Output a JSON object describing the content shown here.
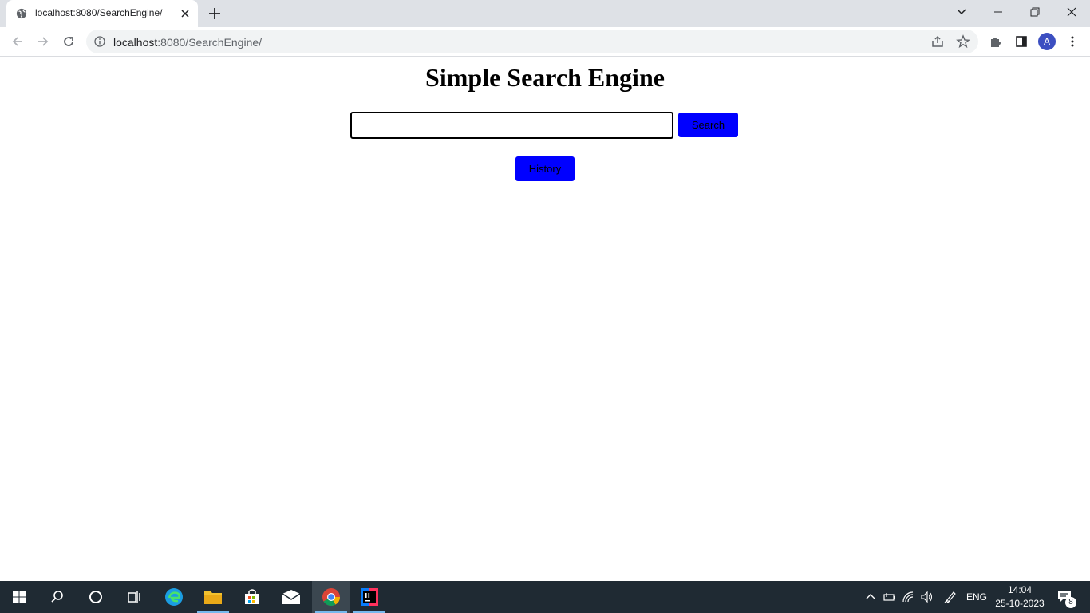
{
  "browser": {
    "tab": {
      "title": "localhost:8080/SearchEngine/"
    },
    "address": {
      "host": "localhost",
      "path": ":8080/SearchEngine/"
    },
    "profile_initial": "A"
  },
  "page": {
    "title": "Simple Search Engine",
    "search_input": {
      "value": "",
      "placeholder": ""
    },
    "search_button": "Search",
    "history_button": "History",
    "button_color": "#0000ff"
  },
  "taskbar": {
    "apps": [
      "windows-start-icon",
      "search-icon",
      "cortana-icon",
      "task-view-icon",
      "edge-icon",
      "file-explorer-icon",
      "store-icon",
      "mail-icon",
      "chrome-icon",
      "intellij-icon"
    ],
    "language": "ENG",
    "time": "14:04",
    "date": "25-10-2023",
    "notification_count": "8"
  }
}
